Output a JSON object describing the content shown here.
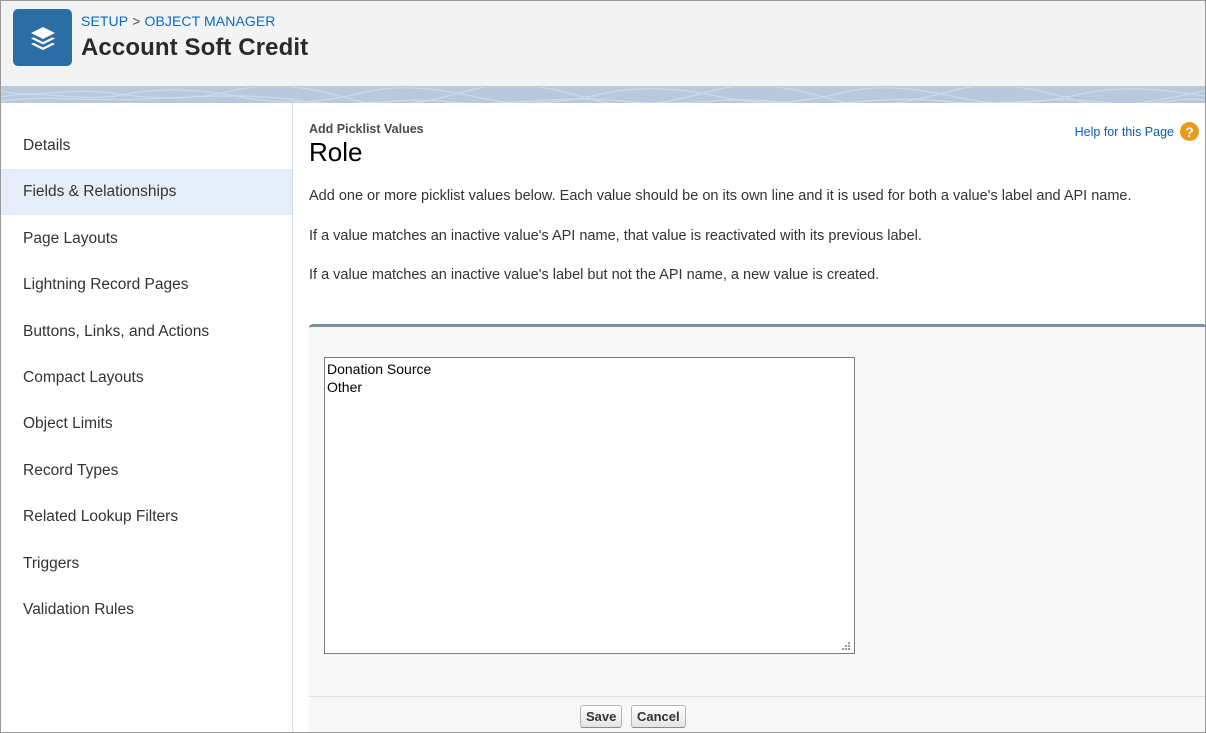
{
  "header": {
    "breadcrumb": [
      "SETUP",
      "OBJECT MANAGER"
    ],
    "breadcrumb_separator": ">",
    "title": "Account Soft Credit",
    "icon": "layers-icon"
  },
  "sidebar": {
    "items": [
      {
        "label": "Details",
        "active": false
      },
      {
        "label": "Fields & Relationships",
        "active": true
      },
      {
        "label": "Page Layouts",
        "active": false
      },
      {
        "label": "Lightning Record Pages",
        "active": false
      },
      {
        "label": "Buttons, Links, and Actions",
        "active": false
      },
      {
        "label": "Compact Layouts",
        "active": false
      },
      {
        "label": "Object Limits",
        "active": false
      },
      {
        "label": "Record Types",
        "active": false
      },
      {
        "label": "Related Lookup Filters",
        "active": false
      },
      {
        "label": "Triggers",
        "active": false
      },
      {
        "label": "Validation Rules",
        "active": false
      }
    ]
  },
  "main": {
    "subtitle": "Add Picklist Values",
    "title": "Role",
    "help_link": "Help for this Page",
    "help_icon": "help-icon",
    "instructions": [
      "Add one or more picklist values below. Each value should be on its own line and it is used for both a value's label and API name.",
      "If a value matches an inactive value's API name, that value is reactivated with its previous label.",
      "If a value matches an inactive value's label but not the API name, a new value is created."
    ],
    "picklist_values": "Donation Source\nOther",
    "save_label": "Save",
    "cancel_label": "Cancel"
  },
  "colors": {
    "brand_icon": "#2b6da5",
    "link": "#0a6bc2",
    "active_nav": "#e5eef8",
    "help_icon": "#e99a1a",
    "panel_top": "#7e8da1"
  }
}
